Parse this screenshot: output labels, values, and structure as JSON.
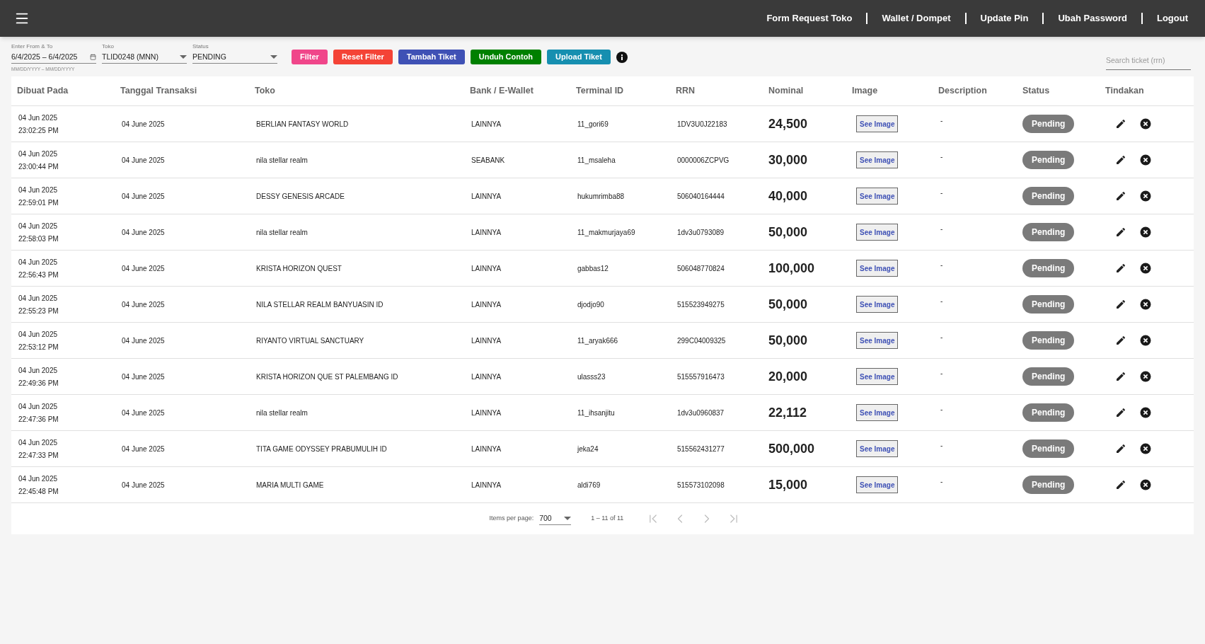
{
  "header": {
    "nav": [
      "Form Request Toko",
      "Wallet / Dompet",
      "Update Pin",
      "Ubah Password",
      "Logout"
    ]
  },
  "filters": {
    "date_range": {
      "label": "Enter From & To",
      "value": "6/4/2025 – 6/4/2025",
      "hint": "MM/DD/YYYY – MM/DD/YYYY"
    },
    "toko": {
      "label": "Toko",
      "value": "TLID0248 (MNN)"
    },
    "status": {
      "label": "Status",
      "value": "PENDING"
    },
    "buttons": [
      {
        "label": "Filter",
        "color": "#f0468a"
      },
      {
        "label": "Reset Filter",
        "color": "#f44336"
      },
      {
        "label": "Tambah Tiket",
        "color": "#3f51b5"
      },
      {
        "label": "Unduh Contoh",
        "color": "#008000"
      },
      {
        "label": "Upload Tiket",
        "color": "#168fb0"
      }
    ],
    "search": {
      "placeholder": "Search ticket (rrn)"
    }
  },
  "table": {
    "columns": [
      "Dibuat Pada",
      "Tanggal Transaksi",
      "Toko",
      "Bank / E-Wallet",
      "Terminal ID",
      "RRN",
      "Nominal",
      "Image",
      "Description",
      "Status",
      "Tindakan"
    ],
    "rows": [
      {
        "created_date": "04 Jun 2025",
        "created_time": "23:02:25 PM",
        "transaction_date": "04 June 2025",
        "toko": "BERLIAN FANTASY WORLD",
        "bank": "LAINNYA",
        "terminal_id": "11_gori69",
        "rrn": "1DV3U0J22183",
        "nominal": "24,500",
        "image": "See Image",
        "description": "-",
        "status": "Pending"
      },
      {
        "created_date": "04 Jun 2025",
        "created_time": "23:00:44 PM",
        "transaction_date": "04 June 2025",
        "toko": "nila stellar realm",
        "bank": "SEABANK",
        "terminal_id": "11_msaleha",
        "rrn": "0000006ZCPVG",
        "nominal": "30,000",
        "image": "See Image",
        "description": "-",
        "status": "Pending"
      },
      {
        "created_date": "04 Jun 2025",
        "created_time": "22:59:01 PM",
        "transaction_date": "04 June 2025",
        "toko": "DESSY GENESIS ARCADE",
        "bank": "LAINNYA",
        "terminal_id": "hukumrimba88",
        "rrn": "506040164444",
        "nominal": "40,000",
        "image": "See Image",
        "description": "-",
        "status": "Pending"
      },
      {
        "created_date": "04 Jun 2025",
        "created_time": "22:58:03 PM",
        "transaction_date": "04 June 2025",
        "toko": "nila stellar realm",
        "bank": "LAINNYA",
        "terminal_id": "11_makmurjaya69",
        "rrn": "1dv3u0793089",
        "nominal": "50,000",
        "image": "See Image",
        "description": "-",
        "status": "Pending"
      },
      {
        "created_date": "04 Jun 2025",
        "created_time": "22:56:43 PM",
        "transaction_date": "04 June 2025",
        "toko": "KRISTA HORIZON QUEST",
        "bank": "LAINNYA",
        "terminal_id": "gabbas12",
        "rrn": "506048770824",
        "nominal": "100,000",
        "image": "See Image",
        "description": "-",
        "status": "Pending"
      },
      {
        "created_date": "04 Jun 2025",
        "created_time": "22:55:23 PM",
        "transaction_date": "04 June 2025",
        "toko": "NILA STELLAR REALM BANYUASIN ID",
        "bank": "LAINNYA",
        "terminal_id": "djodjo90",
        "rrn": "515523949275",
        "nominal": "50,000",
        "image": "See Image",
        "description": "-",
        "status": "Pending"
      },
      {
        "created_date": "04 Jun 2025",
        "created_time": "22:53:12 PM",
        "transaction_date": "04 June 2025",
        "toko": "RIYANTO VIRTUAL SANCTUARY",
        "bank": "LAINNYA",
        "terminal_id": "11_aryak666",
        "rrn": "299C04009325",
        "nominal": "50,000",
        "image": "See Image",
        "description": "-",
        "status": "Pending"
      },
      {
        "created_date": "04 Jun 2025",
        "created_time": "22:49:36 PM",
        "transaction_date": "04 June 2025",
        "toko": "KRISTA HORIZON QUE ST PALEMBANG ID",
        "bank": "LAINNYA",
        "terminal_id": "ulasss23",
        "rrn": "515557916473",
        "nominal": "20,000",
        "image": "See Image",
        "description": "-",
        "status": "Pending"
      },
      {
        "created_date": "04 Jun 2025",
        "created_time": "22:47:36 PM",
        "transaction_date": "04 June 2025",
        "toko": "nila stellar realm",
        "bank": "LAINNYA",
        "terminal_id": "11_ihsanjitu",
        "rrn": "1dv3u0960837",
        "nominal": "22,112",
        "image": "See Image",
        "description": "-",
        "status": "Pending"
      },
      {
        "created_date": "04 Jun 2025",
        "created_time": "22:47:33 PM",
        "transaction_date": "04 June 2025",
        "toko": "TITA GAME ODYSSEY PRABUMULIH ID",
        "bank": "LAINNYA",
        "terminal_id": "jeka24",
        "rrn": "515562431277",
        "nominal": "500,000",
        "image": "See Image",
        "description": "-",
        "status": "Pending"
      },
      {
        "created_date": "04 Jun 2025",
        "created_time": "22:45:48 PM",
        "transaction_date": "04 June 2025",
        "toko": "MARIA MULTI GAME",
        "bank": "LAINNYA",
        "terminal_id": "aldi769",
        "rrn": "515573102098",
        "nominal": "15,000",
        "image": "See Image",
        "description": "-",
        "status": "Pending"
      }
    ]
  },
  "pagination": {
    "items_per_page_label": "Items per page:",
    "items_per_page": "700",
    "range": "1 – 11 of 11",
    "buttons": [
      {
        "kind": "first",
        "disabled": true
      },
      {
        "kind": "prev",
        "disabled": true
      },
      {
        "kind": "next",
        "disabled": true
      },
      {
        "kind": "last",
        "disabled": true
      }
    ]
  }
}
